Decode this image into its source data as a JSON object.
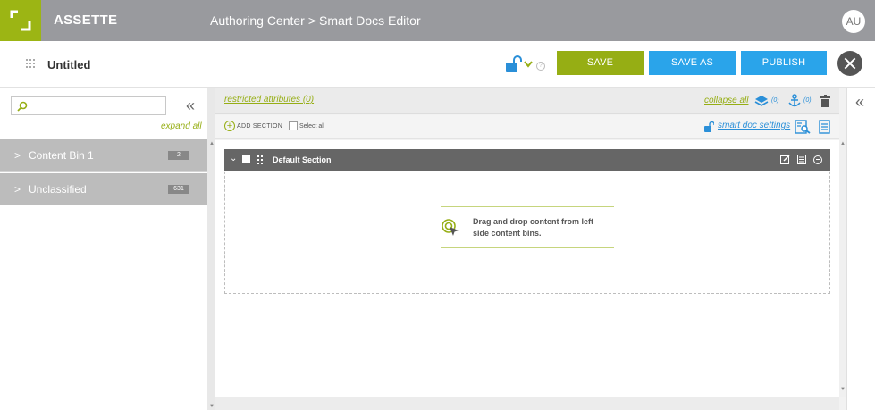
{
  "header": {
    "brand": "ASSETTE",
    "breadcrumb": [
      "Authoring Center",
      "Smart Docs Editor"
    ],
    "avatar_initials": "AU"
  },
  "titlebar": {
    "doc_title": "Untitled",
    "save_label": "SAVE",
    "save_as_label": "SAVE AS",
    "publish_label": "PUBLISH",
    "help_glyph": "?"
  },
  "left_panel": {
    "search": {
      "placeholder": "",
      "value": ""
    },
    "expand_all": "expand all",
    "bins": [
      {
        "label": "Content Bin 1",
        "count": "2"
      },
      {
        "label": "Unclassified",
        "count": "631"
      }
    ]
  },
  "editor": {
    "restricted_attributes": "restricted attributes (0)",
    "collapse_all": "collapse all",
    "layers_count": "(0)",
    "anchors_count": "(0)",
    "add_section": "ADD SECTION",
    "select_all": "Select all",
    "smart_doc_settings": "smart doc settings",
    "section": {
      "title": "Default Section",
      "drop_hint": "Drag and drop content from left side content bins."
    }
  },
  "colors": {
    "accent_green": "#96ae14",
    "accent_blue": "#2aa4ea",
    "topbar_gray": "#999a9e",
    "section_header": "#666666"
  },
  "icons": {
    "logo": "assette-logo-icon",
    "grip": "drag-grip-icon",
    "lock": "lock-open-icon",
    "search": "search-icon",
    "collapse": "double-chevron-left-icon",
    "layers": "layers-icon",
    "anchor": "anchor-icon",
    "trash": "trash-icon",
    "preview": "preview-icon",
    "document": "document-icon",
    "close": "close-icon"
  }
}
